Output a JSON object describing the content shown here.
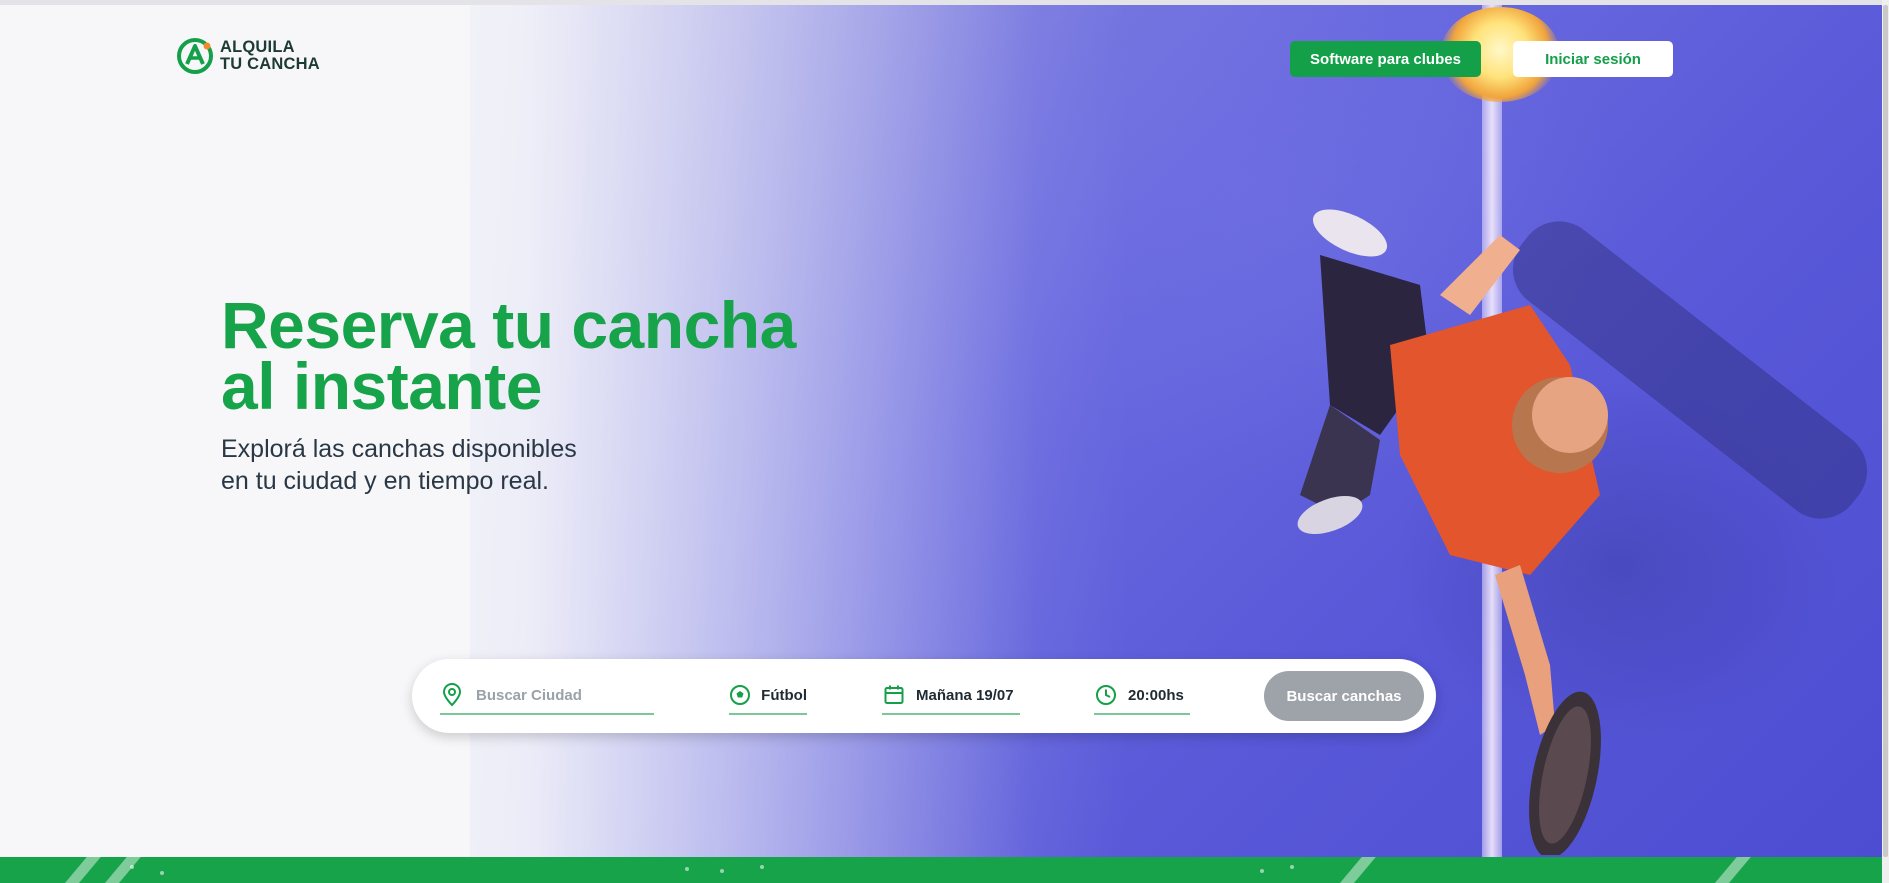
{
  "brand": {
    "line1": "ALQUILA",
    "line2": "TU CANCHA",
    "accent": "#13a049"
  },
  "header": {
    "software_label": "Software para clubes",
    "login_label": "Iniciar sesión"
  },
  "hero": {
    "title_line1": "Reserva tu cancha",
    "title_line2": "al instante",
    "subtitle_line1": "Explorá las canchas disponibles",
    "subtitle_line2": "en tu ciudad y en tiempo real."
  },
  "search": {
    "city_placeholder": "Buscar Ciudad",
    "sport": "Fútbol",
    "date": "Mañana 19/07",
    "time": "20:00hs",
    "submit_label": "Buscar canchas",
    "icons": [
      "location-pin-icon",
      "soccer-ball-icon",
      "calendar-icon",
      "clock-icon"
    ]
  },
  "colors": {
    "primary_green": "#17a34a",
    "disabled_button": "#9ea3aa",
    "court_blue": "#5757d8"
  }
}
